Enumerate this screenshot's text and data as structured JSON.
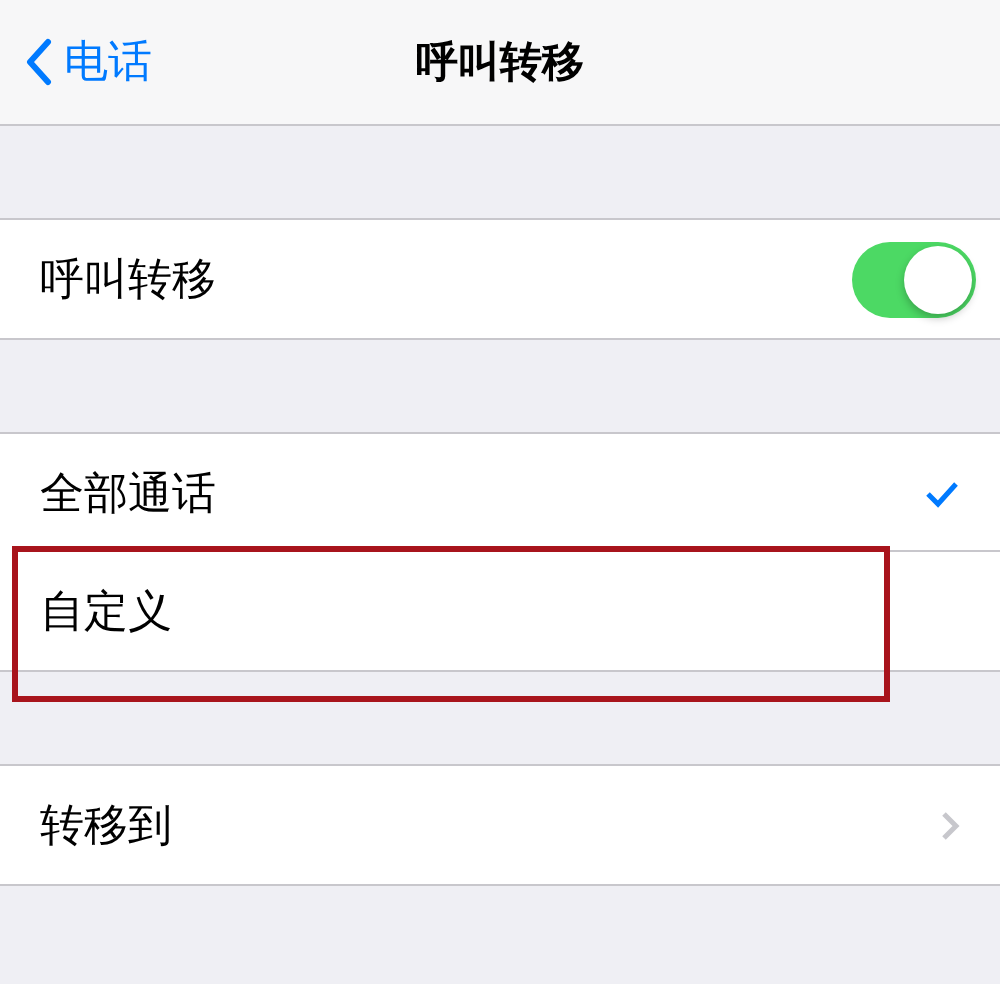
{
  "nav": {
    "back_label": "电话",
    "title": "呼叫转移"
  },
  "sections": [
    {
      "rows": [
        {
          "kind": "toggle",
          "label": "呼叫转移",
          "on": true
        }
      ]
    },
    {
      "rows": [
        {
          "kind": "option",
          "label": "全部通话",
          "selected": true,
          "highlighted": false
        },
        {
          "kind": "option",
          "label": "自定义",
          "selected": false,
          "highlighted": true
        }
      ]
    },
    {
      "rows": [
        {
          "kind": "link",
          "label": "转移到"
        }
      ]
    }
  ]
}
